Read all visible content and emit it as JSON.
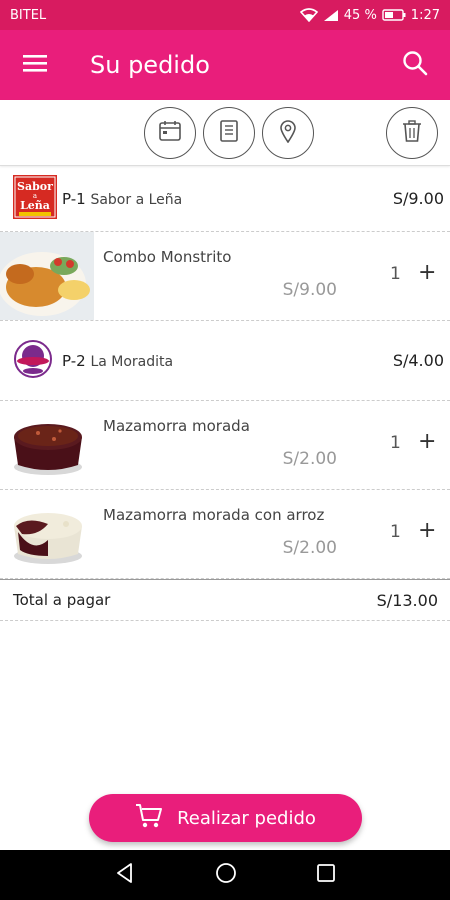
{
  "status": {
    "carrier": "BITEL",
    "battery": "45 %",
    "time": "1:27"
  },
  "app_bar": {
    "title": "Su pedido"
  },
  "colors": {
    "accent": "#e91e7b",
    "status": "#d81b60"
  },
  "toolbar": {
    "icons": [
      "calendar-icon",
      "receipt-icon",
      "location-icon",
      "trash-icon"
    ]
  },
  "stores": [
    {
      "code": "P-1",
      "name": "Sabor a Leña",
      "total": "S/9.00",
      "logo_text": [
        "Sabor",
        "a",
        "Leña"
      ],
      "items": [
        {
          "name": "Combo Monstrito",
          "price": "S/9.00",
          "qty": "1"
        }
      ]
    },
    {
      "code": "P-2",
      "name": "La Moradita",
      "total": "S/4.00",
      "items": [
        {
          "name": "Mazamorra morada",
          "price": "S/2.00",
          "qty": "1"
        },
        {
          "name": "Mazamorra morada con arroz",
          "price": "S/2.00",
          "qty": "1"
        }
      ]
    }
  ],
  "total": {
    "label": "Total a pagar",
    "value": "S/13.00"
  },
  "order_button": {
    "label": "Realizar pedido"
  },
  "plus_symbol": "+"
}
